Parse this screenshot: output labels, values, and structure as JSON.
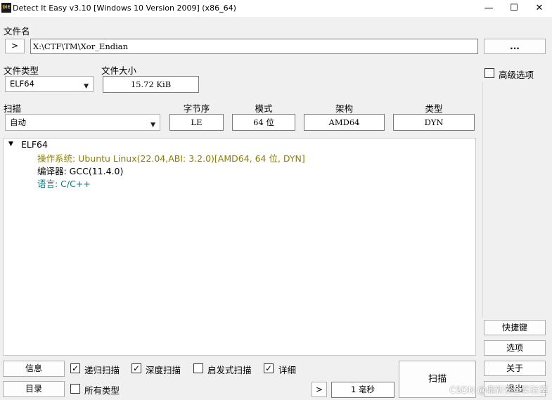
{
  "window": {
    "title": "Detect It Easy v3.10 [Windows 10 Version 2009] (x86_64)",
    "app_icon_text": "DiE",
    "minimize": "—",
    "maximize": "☐",
    "close": "✕"
  },
  "file": {
    "label": "文件名",
    "browse_arrow": ">",
    "path": "X:\\CTF\\TM\\Xor_Endian",
    "more_button": "..."
  },
  "filetype": {
    "label": "文件类型",
    "value": "ELF64",
    "size_label": "文件大小",
    "size_value": "15.72 KiB"
  },
  "advanced": {
    "label": "高级选项",
    "checked": false
  },
  "scan": {
    "label": "扫描",
    "mode": "自动"
  },
  "props": {
    "endianness_label": "字节序",
    "endianness": "LE",
    "mode_label": "模式",
    "mode": "64 位",
    "arch_label": "架构",
    "arch": "AMD64",
    "type_label": "类型",
    "type": "DYN"
  },
  "results": {
    "root": "ELF64",
    "root_toggle": "▼",
    "os": "操作系统: Ubuntu Linux(22.04,ABI: 3.2.0)[AMD64, 64 位, DYN]",
    "compiler": "编译器: GCC(11.4.0)",
    "language": "语言: C/C++",
    "colors": {
      "os": "#8b8000",
      "compiler": "#000000",
      "language": "#008080"
    }
  },
  "side_buttons": {
    "shortcuts": "快捷键",
    "options": "选项",
    "about": "关于",
    "exit": "退出"
  },
  "bottom": {
    "info_button": "信息",
    "dir_button": "目录",
    "recursive": {
      "label": "递归扫描",
      "checked": true
    },
    "deep": {
      "label": "深度扫描",
      "checked": true
    },
    "heuristic": {
      "label": "启发式扫描",
      "checked": false
    },
    "verbose": {
      "label": "详细",
      "checked": true
    },
    "all_types": {
      "label": "所有类型",
      "checked": false
    },
    "next_arrow": ">",
    "time": "1 毫秒",
    "scan_button": "扫描"
  },
  "watermark": "CSDN @鼎新安全实验室"
}
